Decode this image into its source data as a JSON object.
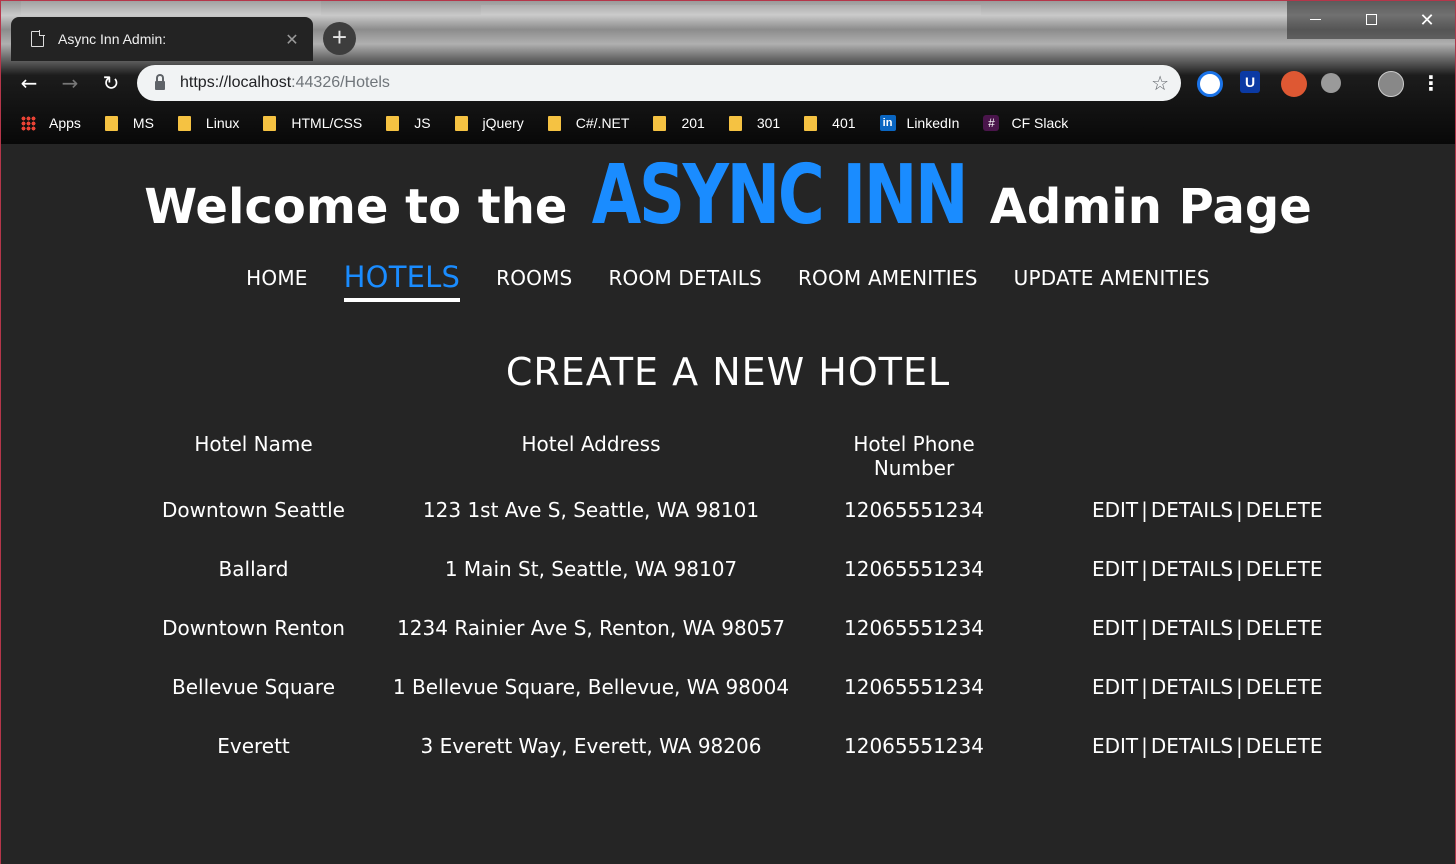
{
  "browser": {
    "tab_title": "Async Inn Admin:",
    "url_host": "https://localhost",
    "url_rest": ":44326/Hotels",
    "bookmarks": [
      "Apps",
      "MS",
      "Linux",
      "HTML/CSS",
      "JS",
      "jQuery",
      "C#/.NET",
      "201",
      "301",
      "401",
      "LinkedIn",
      "CF Slack"
    ]
  },
  "header": {
    "prefix": "Welcome to the",
    "brand": "ASYNC INN",
    "suffix": "Admin Page",
    "brand_color": "#1a8cff"
  },
  "nav": {
    "items": [
      "HOME",
      "HOTELS",
      "ROOMS",
      "ROOM DETAILS",
      "ROOM AMENITIES",
      "UPDATE AMENITIES"
    ],
    "active": "HOTELS"
  },
  "main": {
    "create_link": "CREATE A NEW HOTEL",
    "columns": [
      "Hotel Name",
      "Hotel Address",
      "Hotel Phone Number"
    ],
    "action_labels": {
      "edit": "EDIT",
      "details": "DETAILS",
      "delete": "DELETE",
      "sep": "|"
    },
    "rows": [
      {
        "name": "Downtown Seattle",
        "address": "123 1st Ave S, Seattle, WA 98101",
        "phone": "12065551234"
      },
      {
        "name": "Ballard",
        "address": "1 Main St, Seattle, WA 98107",
        "phone": "12065551234"
      },
      {
        "name": "Downtown Renton",
        "address": "1234 Rainier Ave S, Renton, WA 98057",
        "phone": "12065551234"
      },
      {
        "name": "Bellevue Square",
        "address": "1 Bellevue Square, Bellevue, WA 98004",
        "phone": "12065551234"
      },
      {
        "name": "Everett",
        "address": "3 Everett Way, Everett, WA 98206",
        "phone": "12065551234"
      }
    ]
  }
}
